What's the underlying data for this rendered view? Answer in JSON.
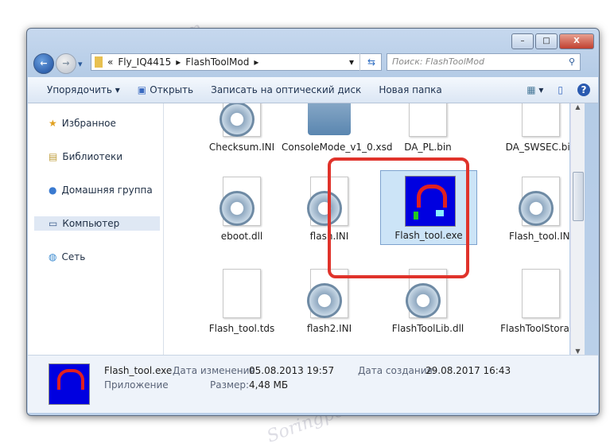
{
  "window": {
    "minimize": "–",
    "maximize": "□",
    "close": "X"
  },
  "nav": {
    "back": "←",
    "forward": "→",
    "history": "▾"
  },
  "address": {
    "prefix": "«",
    "crumbs": [
      "Fly_IQ4415",
      "FlashToolMod"
    ],
    "sep": "▸",
    "dropdown": "▾",
    "refresh": "⇆"
  },
  "search": {
    "placeholder": "Поиск: FlashToolMod",
    "icon": "search-icon"
  },
  "toolbar": {
    "organize": "Упорядочить ▾",
    "open": "Открыть",
    "burn": "Записать на оптический диск",
    "new_folder": "Новая папка",
    "views": "▾",
    "help": "?"
  },
  "sidebar": {
    "items": [
      {
        "label": "Избранное",
        "icon": "★"
      },
      {
        "label": "Библиотеки",
        "icon": "▤"
      },
      {
        "label": "Домашняя группа",
        "icon": "●"
      },
      {
        "label": "Компьютер",
        "icon": "▭"
      },
      {
        "label": "Сеть",
        "icon": "◍"
      }
    ]
  },
  "files": [
    {
      "name": "Checksum.INI",
      "type": "ini"
    },
    {
      "name": "ConsoleMode_v1_0.xsd",
      "type": "xsd"
    },
    {
      "name": "DA_PL.bin",
      "type": "bin"
    },
    {
      "name": "DA_SWSEC.bin",
      "type": "bin"
    },
    {
      "name": "eboot.dll",
      "type": "dll"
    },
    {
      "name": "flash.INI",
      "type": "ini"
    },
    {
      "name": "Flash_tool.exe",
      "type": "exe"
    },
    {
      "name": "Flash_tool.INI",
      "type": "ini"
    },
    {
      "name": "Flash_tool.tds",
      "type": "doc"
    },
    {
      "name": "flash2.INI",
      "type": "ini"
    },
    {
      "name": "FlashToolLib.dll",
      "type": "dll"
    },
    {
      "name": "FlashToolStorage",
      "type": "doc"
    }
  ],
  "details": {
    "name": "Flash_tool.exe",
    "type": "Приложение",
    "modified_label": "Дата изменения:",
    "modified": "05.08.2013 19:57",
    "created_label": "Дата создания:",
    "created": "29.08.2017 16:43",
    "size_label": "Размер:",
    "size": "4,48 МБ"
  },
  "watermark": "Soringpcrepair.com",
  "colors": {
    "highlight": "#e0332b",
    "selection": "#cce4f7"
  }
}
